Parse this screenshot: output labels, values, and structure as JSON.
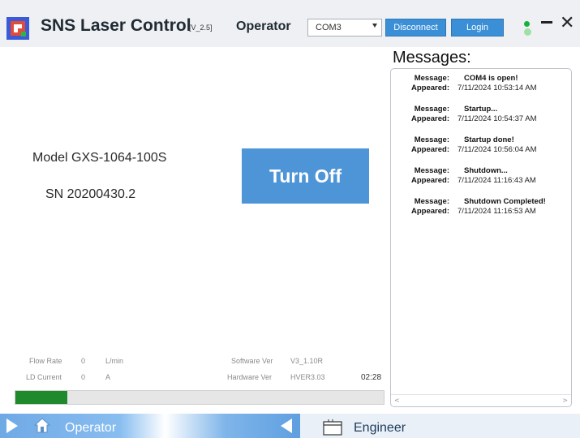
{
  "header": {
    "app_title": "SNS Laser Control",
    "version": "[V_2.5]",
    "mode_label": "Operator",
    "com_port": "COM3",
    "disconnect_label": "Disconnect",
    "login_label": "Login"
  },
  "main": {
    "model": "Model GXS-1064-100S",
    "serial": "SN 20200430.2",
    "turn_off_label": "Turn Off",
    "stats": {
      "flow_rate_label": "Flow Rate",
      "flow_rate_value": "0",
      "flow_rate_unit": "L/min",
      "ld_current_label": "LD Current",
      "ld_current_value": "0",
      "ld_current_unit": "A",
      "software_ver_label": "Software Ver",
      "software_ver_value": "V3_1.10R",
      "hardware_ver_label": "Hardware Ver",
      "hardware_ver_value": "HVER3.03",
      "timer": "02:28"
    },
    "progress_fraction": 0.14
  },
  "messages": {
    "title": "Messages:",
    "message_key": "Message:",
    "appeared_key": "Appeared:",
    "items": [
      {
        "message": "COM4 is open!",
        "appeared": "7/11/2024 10:53:14 AM"
      },
      {
        "message": "Startup...",
        "appeared": "7/11/2024 10:54:37 AM"
      },
      {
        "message": "Startup done!",
        "appeared": "7/11/2024 10:56:04 AM"
      },
      {
        "message": "Shutdown...",
        "appeared": "7/11/2024 11:16:43 AM"
      },
      {
        "message": "Shutdown Completed!",
        "appeared": "7/11/2024 11:16:53 AM"
      }
    ]
  },
  "tabs": {
    "operator_label": "Operator",
    "engineer_label": "Engineer"
  },
  "colors": {
    "accent": "#3a8fd6",
    "progress": "#1e8a2c",
    "status_ok": "#16b23c"
  },
  "icons": [
    "app-logo-icon",
    "dropdown-arrow-icon",
    "minimize-icon",
    "close-icon",
    "home-icon",
    "window-icon",
    "scroll-left-icon",
    "scroll-right-icon"
  ]
}
